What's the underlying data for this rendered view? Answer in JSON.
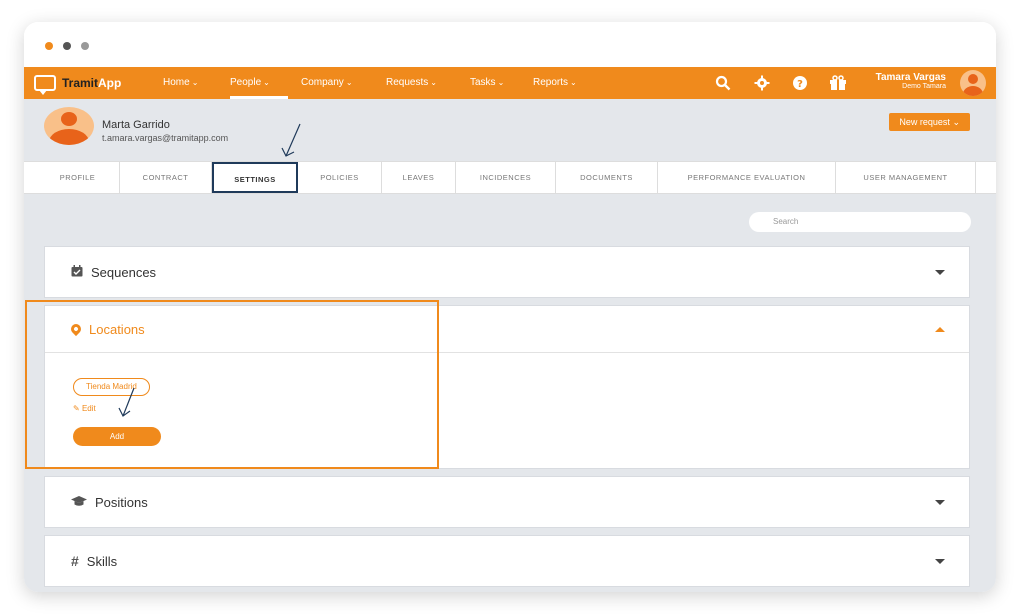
{
  "nav": {
    "brand_part1": "Tramit",
    "brand_part2": "App",
    "items": [
      {
        "label": "Home"
      },
      {
        "label": "People"
      },
      {
        "label": "Company"
      },
      {
        "label": "Requests"
      },
      {
        "label": "Tasks"
      },
      {
        "label": "Reports"
      }
    ],
    "user_name": "Tamara Vargas",
    "user_sub": "Demo Tamara"
  },
  "profile": {
    "name": "Marta Garrido",
    "email": "t.amara.vargas@tramitapp.com",
    "new_request_label": "New request"
  },
  "tabs": [
    "PROFILE",
    "CONTRACT",
    "SETTINGS",
    "POLICIES",
    "LEAVES",
    "INCIDENCES",
    "DOCUMENTS",
    "PERFORMANCE EVALUATION",
    "USER MANAGEMENT"
  ],
  "search": {
    "placeholder": "Search"
  },
  "sections": {
    "sequences": "Sequences",
    "locations": "Locations",
    "positions": "Positions",
    "skills": "Skills"
  },
  "locations": {
    "chip": "Tienda Madrid",
    "edit_label": "Edit",
    "add_label": "Add"
  },
  "colors": {
    "accent": "#f08a1c",
    "tab_highlight": "#1f3a5a",
    "background": "#e4e7eb"
  }
}
